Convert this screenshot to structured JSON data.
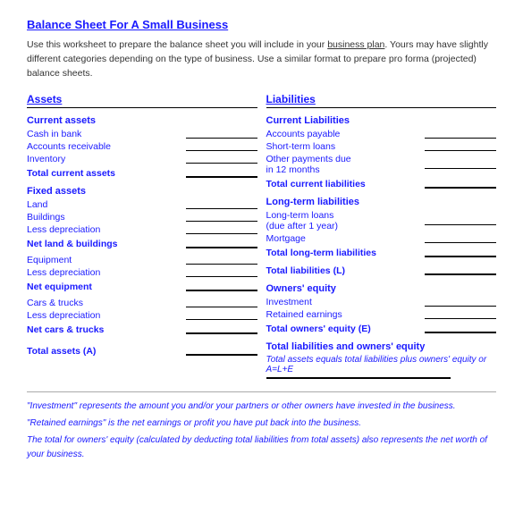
{
  "title": "Balance Sheet For A Small Business",
  "intro": "Use this worksheet to prepare the balance sheet you will include in your business plan.  Yours may have slightly different categories depending on the type of business.  Use a similar format to prepare pro forma (projected) balance sheets.",
  "assets_header": "Assets",
  "liabilities_header": "Liabilities",
  "assets": {
    "current_title": "Current assets",
    "current_items": [
      "Cash in bank",
      "Accounts receivable",
      "Inventory",
      "Total current assets"
    ],
    "fixed_title": "Fixed assets",
    "fixed_items": [
      {
        "label": "Land",
        "bold": false
      },
      {
        "label": "Buildings",
        "bold": false
      },
      {
        "label": "Less depreciation",
        "bold": false
      },
      {
        "label": "Net land & buildings",
        "bold": true
      }
    ],
    "equipment_items": [
      {
        "label": "Equipment",
        "bold": false
      },
      {
        "label": "Less depreciation",
        "bold": false
      },
      {
        "label": "Net equipment",
        "bold": true
      }
    ],
    "cars_items": [
      {
        "label": "Cars & trucks",
        "bold": false
      },
      {
        "label": "Less depreciation",
        "bold": false
      },
      {
        "label": "Net cars & trucks",
        "bold": true
      }
    ],
    "total": "Total assets (A)"
  },
  "liabilities": {
    "current_title": "Current Liabilities",
    "current_items": [
      "Accounts payable",
      "Short-term loans",
      "Other payments due in 12 months",
      "Total current liabilities"
    ],
    "longterm_title": "Long-term liabilities",
    "longterm_items": [
      "Long-term loans (due after 1 year)",
      "Mortgage",
      "Total long-term liabilities"
    ],
    "total_liab": "Total liabilities (L)",
    "equity_title": "Owners' equity",
    "equity_items": [
      "Investment",
      "Retained earnings"
    ],
    "total_equity": "Total owners' equity (E)",
    "total_liab_equity_title": "Total liabilities and owners' equity",
    "total_liab_equity_sub": "Total assets equals total liabilities plus owners' equity or A=L+E"
  },
  "footer": {
    "line1": "\"Investment\" represents the amount you and/or your partners or other owners have invested in the business.",
    "line2": "\"Retained earnings\" is the net earnings or profit you have put back into the business.",
    "line3": "The total for owners' equity (calculated by deducting total liabilities from total assets) also represents the net worth of your business."
  }
}
